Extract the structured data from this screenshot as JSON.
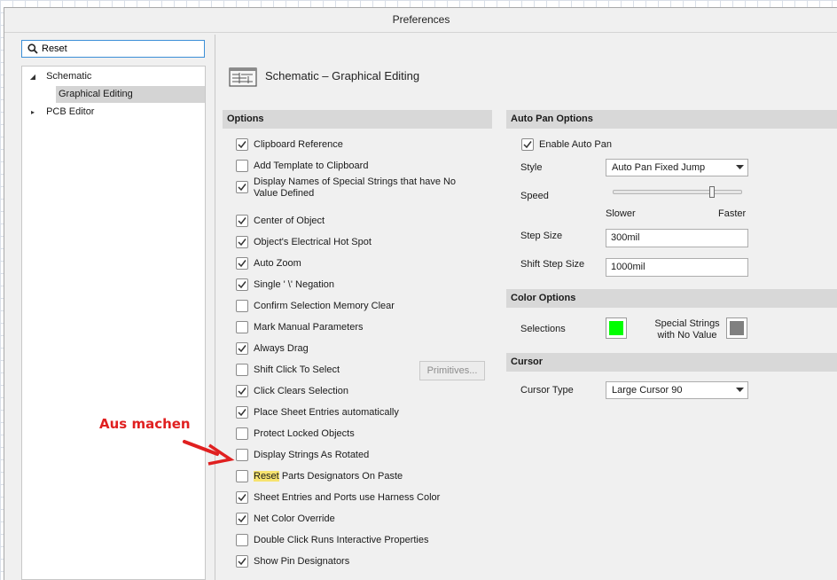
{
  "window": {
    "title": "Preferences"
  },
  "search": {
    "value": "Reset"
  },
  "tree": [
    {
      "label": "Schematic",
      "expanded": true
    },
    {
      "label": "Graphical Editing",
      "selected": true
    },
    {
      "label": "PCB Editor",
      "expanded": false
    }
  ],
  "page": {
    "title": "Schematic – Graphical Editing"
  },
  "options": {
    "header": "Options",
    "items": [
      {
        "label": "Clipboard Reference",
        "checked": true
      },
      {
        "label": "Add Template to Clipboard",
        "checked": false
      },
      {
        "label": "Display Names of Special Strings that have No Value Defined",
        "checked": true
      },
      {
        "label": "Center of Object",
        "checked": true
      },
      {
        "label": "Object's Electrical Hot Spot",
        "checked": true
      },
      {
        "label": "Auto Zoom",
        "checked": true
      },
      {
        "label": "Single ' \\' Negation",
        "checked": true
      },
      {
        "label": "Confirm Selection Memory Clear",
        "checked": false
      },
      {
        "label": "Mark Manual Parameters",
        "checked": false
      },
      {
        "label": "Always Drag",
        "checked": true
      },
      {
        "label": "Shift Click To Select",
        "checked": false
      },
      {
        "label": "Click Clears Selection",
        "checked": true
      },
      {
        "label": "Place Sheet Entries automatically",
        "checked": true
      },
      {
        "label": "Protect Locked Objects",
        "checked": false
      },
      {
        "label": "Display Strings As Rotated",
        "checked": false
      },
      {
        "label": "Parts Designators On Paste",
        "highlight": "Reset",
        "checked": false
      },
      {
        "label": "Sheet Entries and Ports use Harness Color",
        "checked": true
      },
      {
        "label": "Net Color Override",
        "checked": true
      },
      {
        "label": "Double Click Runs Interactive Properties",
        "checked": false
      },
      {
        "label": "Show Pin Designators",
        "checked": true
      }
    ],
    "primitives_button": "Primitives..."
  },
  "auto_pan": {
    "header": "Auto Pan Options",
    "enable_label": "Enable Auto Pan",
    "enabled": true,
    "style_label": "Style",
    "style_value": "Auto Pan Fixed Jump",
    "speed_label": "Speed",
    "speed_level": 0.77,
    "slower_label": "Slower",
    "faster_label": "Faster",
    "step_size_label": "Step Size",
    "step_size_value": "300mil",
    "shift_step_size_label": "Shift Step Size",
    "shift_step_size_value": "1000mil"
  },
  "color_options": {
    "header": "Color Options",
    "selections_label": "Selections",
    "selections_color": "#00ff00",
    "special_strings_label_line1": "Special Strings",
    "special_strings_label_line2": "with No Value",
    "special_strings_color": "#808080"
  },
  "cursor": {
    "header": "Cursor",
    "type_label": "Cursor Type",
    "type_value": "Large Cursor 90"
  },
  "annotation": {
    "text": "Aus machen",
    "color": "#e02020"
  }
}
